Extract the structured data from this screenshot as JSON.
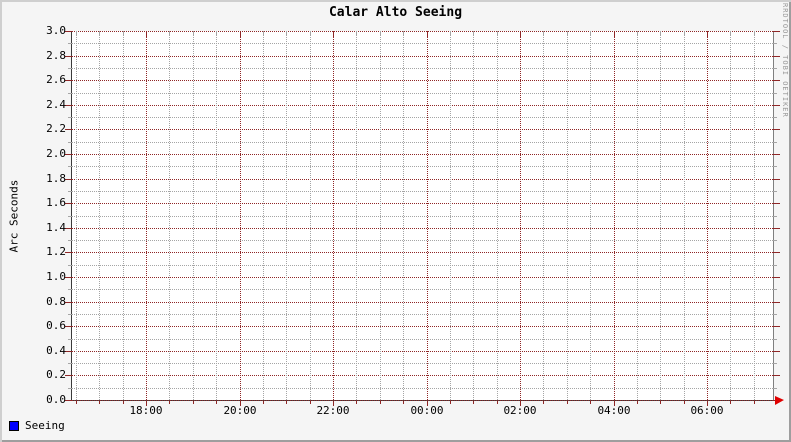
{
  "title": "Calar Alto Seeing",
  "watermark": "RRDTOOL / TOBI OETIKER",
  "chart_data": {
    "type": "line",
    "title": "Calar Alto Seeing",
    "xlabel": "",
    "ylabel": "Arc Seconds",
    "ylim": [
      0.0,
      3.0
    ],
    "y_major_step": 0.2,
    "y_minor_step": 0.1,
    "y_tick_labels": [
      "0.0",
      "0.2",
      "0.4",
      "0.6",
      "0.8",
      "1.0",
      "1.2",
      "1.4",
      "1.6",
      "1.8",
      "2.0",
      "2.2",
      "2.4",
      "2.6",
      "2.8",
      "3.0"
    ],
    "x_tick_labels": [
      "18:00",
      "20:00",
      "22:00",
      "00:00",
      "02:00",
      "04:00",
      "06:00"
    ],
    "x_minor_per_major": 4,
    "grid": true,
    "legend_position": "bottom-left",
    "legend": [
      {
        "label": "Seeing",
        "color": "#0000ff"
      }
    ],
    "series": [
      {
        "name": "Seeing",
        "values": []
      }
    ]
  },
  "colors": {
    "background": "#f5f5f5",
    "canvas": "#ffffff",
    "major_grid": "#8f2727",
    "minor_grid": "#a5a5a5",
    "axis": "#3a3a3a",
    "frame_right_edge": "#808080",
    "arrow": "#e00000",
    "text": "#000000",
    "watermark": "#999999",
    "legend_swatch": "#0000ff"
  }
}
